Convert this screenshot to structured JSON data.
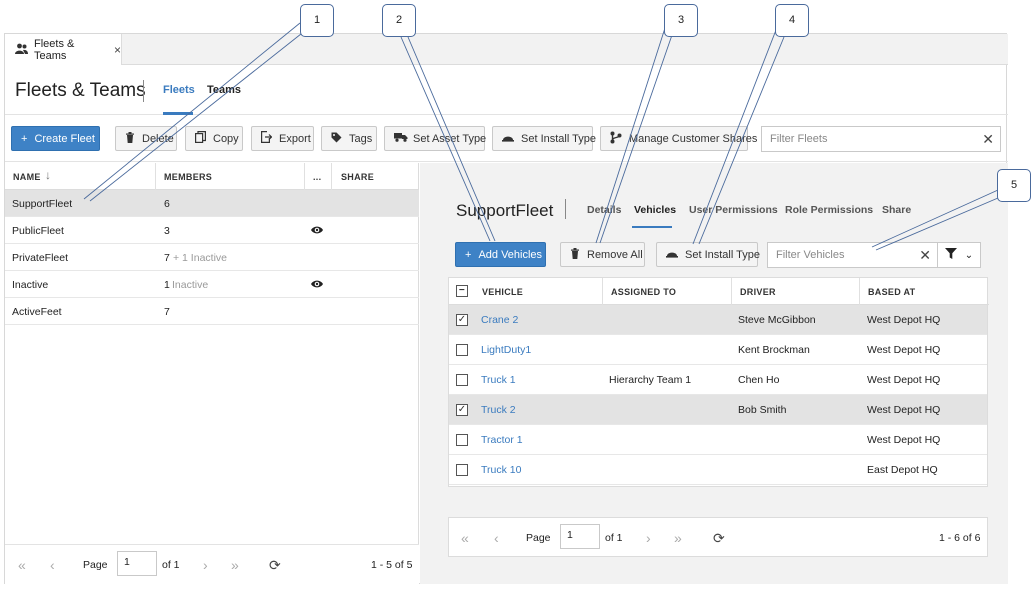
{
  "doc_tab": {
    "label": "Fleets & Teams",
    "close": "×"
  },
  "header": {
    "title": "Fleets & Teams",
    "tabs": [
      {
        "label": "Fleets"
      },
      {
        "label": "Teams"
      }
    ]
  },
  "toolbar": {
    "create": "Create Fleet",
    "delete": "Delete",
    "copy": "Copy",
    "export": "Export",
    "tags": "Tags",
    "set_asset_type": "Set Asset Type",
    "set_install_type": "Set Install Type",
    "manage_shares": "Manage Customer Shares",
    "filter_placeholder": "Filter Fleets"
  },
  "fleet_grid": {
    "columns": [
      "NAME",
      "MEMBERS",
      "...",
      "SHARE"
    ],
    "rows": [
      {
        "name": "SupportFleet",
        "members": "6",
        "extra": "",
        "shared": false
      },
      {
        "name": "PublicFleet",
        "members": "3",
        "extra": "",
        "shared": true
      },
      {
        "name": "PrivateFleet",
        "members": "7",
        "extra": "+ 1 Inactive",
        "shared": false
      },
      {
        "name": "Inactive",
        "members": "1",
        "extra": "Inactive",
        "shared": true
      },
      {
        "name": "ActiveFeet",
        "members": "7",
        "extra": "",
        "shared": false
      }
    ]
  },
  "fleet_pager": {
    "page_label": "Page",
    "page": "1",
    "of": "of 1",
    "summary": "1 - 5 of 5"
  },
  "detail": {
    "title": "SupportFleet",
    "tabs": [
      "Details",
      "Vehicles",
      "User Permissions",
      "Role Permissions",
      "Share"
    ],
    "toolbar": {
      "add": "Add Vehicles",
      "remove_all": "Remove All",
      "set_install_type": "Set Install Type",
      "filter_placeholder": "Filter Vehicles"
    },
    "columns": [
      "VEHICLE",
      "ASSIGNED TO",
      "DRIVER",
      "BASED AT"
    ],
    "rows": [
      {
        "vehicle": "Crane 2",
        "assigned": "",
        "driver": "Steve McGibbon",
        "based": "West Depot HQ",
        "checked": true
      },
      {
        "vehicle": "LightDuty1",
        "assigned": "",
        "driver": "Kent Brockman",
        "based": "West Depot HQ",
        "checked": false
      },
      {
        "vehicle": "Truck 1",
        "assigned": "Hierarchy Team 1",
        "driver": "Chen Ho",
        "based": "West Depot HQ",
        "checked": false
      },
      {
        "vehicle": "Truck 2",
        "assigned": "",
        "driver": "Bob Smith",
        "based": "West Depot HQ",
        "checked": true
      },
      {
        "vehicle": "Tractor 1",
        "assigned": "",
        "driver": "",
        "based": "West Depot HQ",
        "checked": false
      },
      {
        "vehicle": "Truck 10",
        "assigned": "",
        "driver": "",
        "based": "East Depot HQ",
        "checked": false
      }
    ],
    "pager": {
      "page_label": "Page",
      "page": "1",
      "of": "of 1",
      "summary": "1 - 6 of 6"
    }
  },
  "callouts": [
    "1",
    "2",
    "3",
    "4",
    "5"
  ],
  "colors": {
    "accent": "#3a7bbf",
    "primary_button": "#3e82c6",
    "selected_row": "#e3e3e3"
  }
}
